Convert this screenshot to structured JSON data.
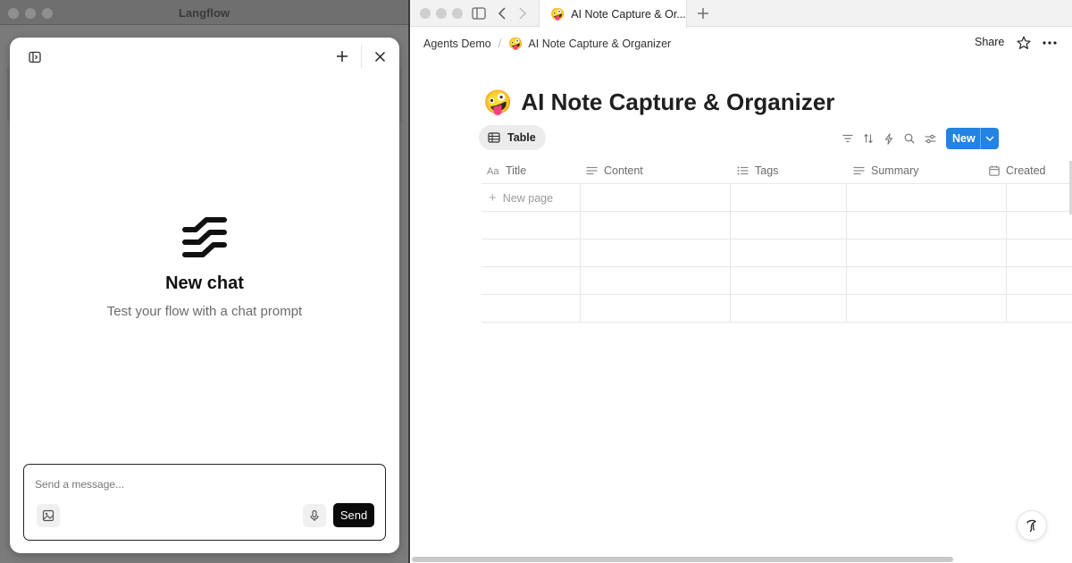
{
  "left_window": {
    "title": "Langflow",
    "chat": {
      "empty_title": "New chat",
      "empty_subtitle": "Test your flow with a chat prompt",
      "input_placeholder": "Send a message...",
      "send_label": "Send",
      "icons": [
        "sidebar-toggle-icon",
        "plus-icon",
        "close-icon",
        "langflow-logo",
        "image-icon",
        "microphone-icon"
      ]
    }
  },
  "right_window": {
    "tab": {
      "emoji": "🤪",
      "title": "AI Note Capture & Or..."
    },
    "breadcrumb": {
      "workspace": "Agents Demo",
      "separator": "/",
      "page_emoji": "🤪",
      "page": "AI Note Capture & Organizer"
    },
    "share_label": "Share",
    "page": {
      "emoji": "🤪",
      "title": "AI Note Capture & Organizer"
    },
    "view_tab_label": "Table",
    "new_button_label": "New",
    "toolbar_icons": [
      "filter-icon",
      "sort-icon",
      "automation-icon",
      "search-icon",
      "settings-icon"
    ],
    "table": {
      "columns": [
        {
          "label": "Title",
          "icon": "text-type-icon"
        },
        {
          "label": "Content",
          "icon": "lines-icon"
        },
        {
          "label": "Tags",
          "icon": "list-icon"
        },
        {
          "label": "Summary",
          "icon": "lines-icon"
        },
        {
          "label": "Created",
          "icon": "calendar-icon"
        }
      ],
      "new_row_label": "New page"
    }
  }
}
